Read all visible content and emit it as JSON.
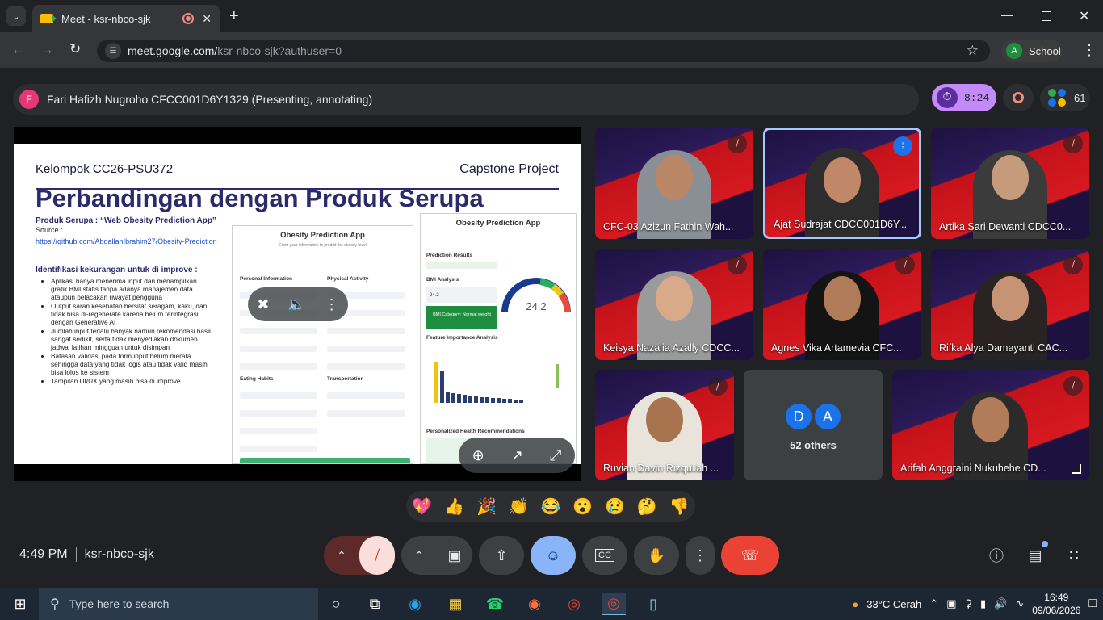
{
  "browser": {
    "tab_title": "Meet - ksr-nbco-sjk",
    "new_tab_symbol": "+",
    "url_host": "meet.google.com/",
    "url_path": "ksr-nbco-sjk?authuser=0",
    "profile_initial": "A",
    "profile_label": "School"
  },
  "meet": {
    "presenter_initial": "F",
    "presenter_label": "Fari Hafizh Nugroho CFCC001D6Y1329 (Presenting, annotating)",
    "timer": "8:24",
    "participant_count": "61",
    "meeting_time": "4:49 PM",
    "meeting_code": "ksr-nbco-sjk",
    "others_initials": [
      "D",
      "A"
    ],
    "others_label": "52 others"
  },
  "slide": {
    "group": "Kelompok CC26-PSU372",
    "project": "Capstone Project",
    "title": "Perbandingan dengan Produk Serupa",
    "product": "Produk Serupa : “Web Obesity Prediction App”",
    "source_label": "Source :",
    "source_link": "https://github.com/AbdallahIbrahim27/Obesity-Prediction",
    "issues_heading": "Identifikasi kekurangan untuk di improve :",
    "issues": [
      "Aplikasi hanya menerima input dan menampilkan grafik BMI statis tanpa adanya manajemen data ataupun pelacakan riwayat pengguna",
      "Output saran kesehatan bersifat seragam, kaku, dan tidak bisa di-regenerate karena belum terintegrasi dengan Generative AI",
      "Jumlah input terlalu banyak namun rekomendasi hasil sangat sedikit, serta tidak menyediakan dokumen jadwal latihan mingguan untuk disimpan",
      "Batasan validasi pada form input belum merata sehingga data yang tidak logis atau tidak valid masih bisa lolos ke sistem",
      "Tampilan UI/UX yang masih bisa di improve"
    ],
    "app_title": "Obesity Prediction App",
    "app_subtitle": "Enter your information to predict the obesity level",
    "app_sections": [
      "Personal Information",
      "Physical Activity",
      "Eating Habits",
      "Transportation"
    ],
    "result_title": "Obesity Prediction App",
    "result_sections": [
      "Prediction Results",
      "BMI Analysis",
      "Feature Importance Analysis",
      "Personalized Health Recommendations"
    ],
    "bmi_value": "24.2",
    "bmi_category": "BMI Category: Normal weight"
  },
  "participants": [
    {
      "name": "CFC-03 Azizun Fathin Wah...",
      "muted": true,
      "skin": "#b98766",
      "cloth": "#8a8f96"
    },
    {
      "name": "Ajat Sudrajat CDCC001D6Y...",
      "muted": false,
      "speaking": true,
      "skin": "#c08868",
      "cloth": "#2d2d2d"
    },
    {
      "name": "Artika Sari Dewanti CDCC0...",
      "muted": true,
      "skin": "#c69b7c",
      "cloth": "#3b3b3b"
    },
    {
      "name": "Keisya Nazalia Azally CDCC...",
      "muted": true,
      "skin": "#d9aa8a",
      "cloth": "#9a9a9a"
    },
    {
      "name": "Agnes Vika Artamevia CFC...",
      "muted": true,
      "skin": "#b07b58",
      "cloth": "#141414"
    },
    {
      "name": "Rifka Alya Damayanti CAC...",
      "muted": true,
      "skin": "#c79375",
      "cloth": "#2a2323"
    },
    {
      "name": "Ruvian Davin Rizqullah ...",
      "muted": true,
      "skin": "#a8744f",
      "cloth": "#e8e4dc"
    },
    {
      "name": "Arifah Anggraini Nukuhehe CD...",
      "muted": true,
      "skin": "#b27c5b",
      "cloth": "#2b2b2b"
    }
  ],
  "taskbar": {
    "search_placeholder": "Type here to search",
    "weather": "33°C  Cerah",
    "time": "16:49",
    "date": "09/06/2026"
  },
  "colors": {
    "accent_purple": "#c58af9",
    "end_call": "#ea4335",
    "emoji_active": "#8ab4f8",
    "mic_off": "#f9dedc"
  }
}
